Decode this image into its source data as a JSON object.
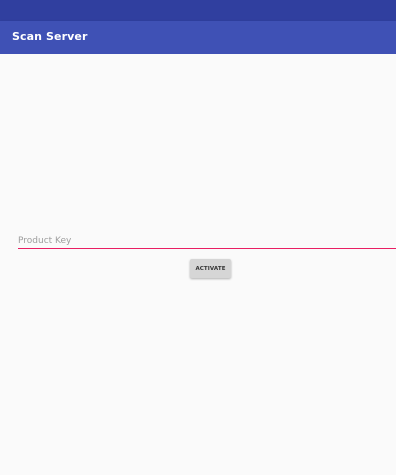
{
  "app_bar": {
    "title": "Scan Server"
  },
  "form": {
    "product_key_placeholder": "Product Key",
    "product_key_value": "",
    "activate_label": "ACTIVATE"
  },
  "colors": {
    "status_bar": "#303f9f",
    "primary": "#3f51b5",
    "accent": "#e91e63",
    "background": "#fafafa",
    "button": "#d6d6d6"
  }
}
